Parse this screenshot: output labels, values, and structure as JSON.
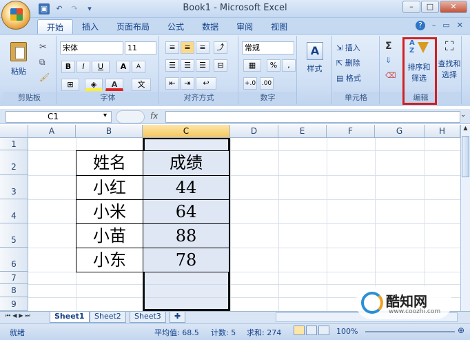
{
  "window": {
    "title": "Book1 - Microsoft Excel",
    "minimize": "–",
    "maximize": "□",
    "close": "✕"
  },
  "tabs": [
    "开始",
    "插入",
    "页面布局",
    "公式",
    "数据",
    "审阅",
    "视图"
  ],
  "ribbon": {
    "clipboard": {
      "paste": "粘贴",
      "label": "剪贴板"
    },
    "font": {
      "name": "宋体",
      "size": "11",
      "bold": "B",
      "italic": "I",
      "underline": "U",
      "grow": "A",
      "shrink": "A",
      "color_letter": "A",
      "wen": "文",
      "label": "字体"
    },
    "alignment": {
      "label": "对齐方式"
    },
    "number": {
      "format": "常规",
      "percent": "%",
      "comma": ",",
      "label": "数字"
    },
    "styles": {
      "label": "样式"
    },
    "cells": {
      "insert": "插入",
      "delete": "删除",
      "format": "格式",
      "label": "单元格"
    },
    "editing": {
      "sort_filter_1": "排序和",
      "sort_filter_2": "筛选",
      "find_1": "查找和",
      "find_2": "选择",
      "label": "编辑"
    }
  },
  "formula_bar": {
    "name_box": "C1",
    "fx": "fx",
    "value": ""
  },
  "columns": [
    "A",
    "B",
    "C",
    "D",
    "E",
    "F",
    "G",
    "H"
  ],
  "rows": [
    "1",
    "2",
    "3",
    "4",
    "5",
    "6",
    "7",
    "8",
    "9"
  ],
  "table": {
    "headers": [
      "姓名",
      "成绩"
    ],
    "rows": [
      [
        "小红",
        "44"
      ],
      [
        "小米",
        "64"
      ],
      [
        "小苗",
        "88"
      ],
      [
        "小东",
        "78"
      ]
    ]
  },
  "sheets": [
    "Sheet1",
    "Sheet2",
    "Sheet3"
  ],
  "status": {
    "mode": "就绪",
    "average": "平均值: 68.5",
    "count": "计数: 5",
    "sum": "求和: 274",
    "zoom": "100%"
  },
  "watermark": {
    "brand": "酷知网",
    "url": "www.coozhi.com"
  },
  "colors": {
    "ribbon": "#dbe6f4",
    "accent": "#15428b",
    "highlight": "#d11f1f",
    "selection": "#dfe7f4"
  }
}
